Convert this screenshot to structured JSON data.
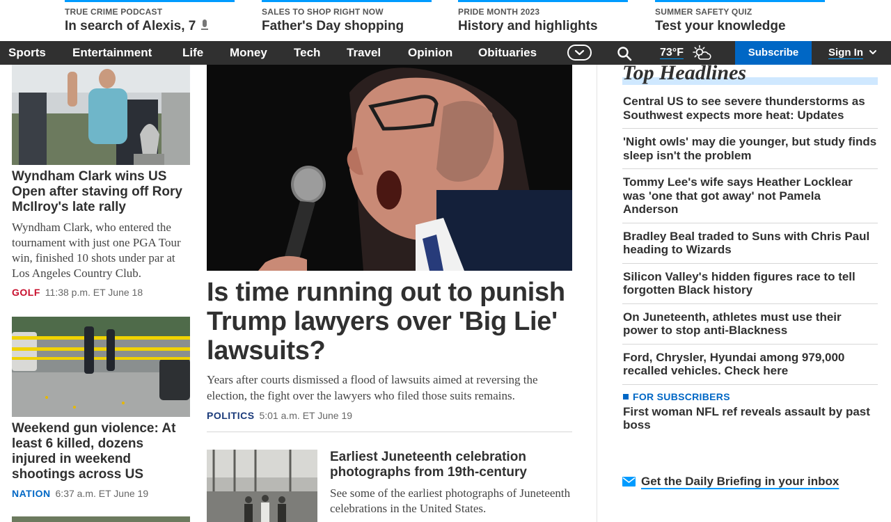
{
  "promos": [
    {
      "kicker": "TRUE CRIME PODCAST",
      "title": "In search of Alexis, 7",
      "icon": "microphone-icon"
    },
    {
      "kicker": "SALES TO SHOP RIGHT NOW",
      "title": "Father's Day shopping"
    },
    {
      "kicker": "PRIDE MONTH 2023",
      "title": "History and highlights"
    },
    {
      "kicker": "SUMMER SAFETY QUIZ",
      "title": "Test your knowledge"
    }
  ],
  "nav": {
    "items": [
      "Sports",
      "Entertainment",
      "Life",
      "Money",
      "Tech",
      "Travel",
      "Opinion",
      "Obituaries"
    ],
    "more_icon": "chevron-down-icon",
    "search_icon": "search-icon",
    "weather_temp": "73°F",
    "weather_icon": "partly-cloudy-icon",
    "subscribe": "Subscribe",
    "signin": "Sign In"
  },
  "left_stories": [
    {
      "title": "Wyndham Clark wins US Open after staving off Rory McIlroy's late rally",
      "summary": "Wyndham Clark, who entered the tournament with just one PGA Tour win, finished 10 shots under par at Los Angeles Country Club.",
      "tag": "GOLF",
      "tag_color": "#c8102e",
      "time": "11:38 p.m. ET June 18"
    },
    {
      "title": "Weekend gun violence: At least 6 killed, dozens injured in weekend shootings across US",
      "tag": "NATION",
      "tag_color": "#0067c5",
      "time": "6:37 a.m. ET June 19"
    }
  ],
  "hero": {
    "title": "Is time running out to punish Trump lawyers over 'Big Lie' lawsuits?",
    "summary": "Years after courts dismissed a flood of lawsuits aimed at reversing the election, the fight over the lawyers who filed those suits remains.",
    "tag": "POLITICS",
    "tag_color": "#1a3a7a",
    "time": "5:01 a.m. ET June 19"
  },
  "sub_story": {
    "title": "Earliest Juneteenth celebration photographs from 19th-century",
    "summary": "See some of the earliest photographs of Juneteenth celebrations in the United States."
  },
  "right": {
    "heading": "Top Headlines",
    "headlines": [
      "Central US to see severe thunderstorms as Southwest expects more heat: Updates",
      "'Night owls' may die younger, but study finds sleep isn't the problem",
      "Tommy Lee's wife says Heather Locklear was 'one that got away' not Pamela Anderson",
      "Bradley Beal traded to Suns with Chris Paul heading to Wizards",
      "Silicon Valley's hidden figures race to tell forgotten Black history",
      "On Juneteenth, athletes must use their power to stop anti-Blackness",
      "Ford, Chrysler, Hyundai among 979,000 recalled vehicles. Check here"
    ],
    "subscriber": {
      "kicker": "FOR SUBSCRIBERS",
      "title": "First woman NFL ref reveals assault by past boss"
    },
    "briefing": "Get the Daily Briefing in your inbox",
    "briefing_icon": "envelope-icon"
  },
  "colors": {
    "nav_bg": "#303030",
    "accent_blue": "#009bff",
    "subscribe_bg": "#0067c5",
    "highlight_bar": "#cfe8ff"
  }
}
